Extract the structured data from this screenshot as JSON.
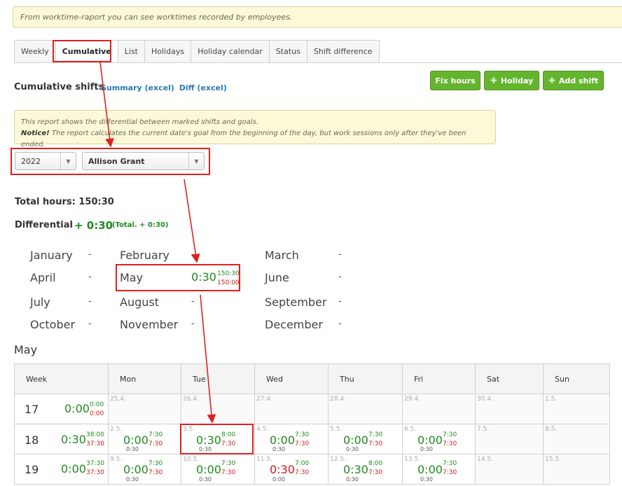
{
  "info_text": "From worktime-raport you can see worktimes recorded by employees.",
  "tabs": [
    {
      "label": "Weekly"
    },
    {
      "label": "Cumulative"
    },
    {
      "label": "List"
    },
    {
      "label": "Holidays"
    },
    {
      "label": "Holiday calendar"
    },
    {
      "label": "Status"
    },
    {
      "label": "Shift difference"
    }
  ],
  "title": "Cumulative shifts",
  "links": {
    "summary": "Summary (excel)",
    "diff": "Diff (excel)"
  },
  "buttons": {
    "fix_hours": "Fix hours",
    "holiday": "Holiday",
    "add_shift": "Add shift"
  },
  "notice": {
    "line1": "This report shows the differential between marked shifts and goals.",
    "notice_label": "Notice!",
    "line2": " The report calculates the current date's goal from the beginning of the day, but work sessions only after they've been ended."
  },
  "selects": {
    "year": "2022",
    "employee": "Allison Grant"
  },
  "total_label": "Total hours:",
  "total_value": "150:30",
  "diff_label": "Differential",
  "diff_value": "+ 0:30",
  "diff_total": "(Total. + 0:30)",
  "months": [
    {
      "name": "January",
      "dash": "-"
    },
    {
      "name": "February",
      "dash": "-"
    },
    {
      "name": "March",
      "dash": "-"
    },
    {
      "name": "April",
      "dash": "-"
    },
    {
      "name": "May",
      "diff": "0:30",
      "worked": "150:30",
      "goal": "150:00"
    },
    {
      "name": "June",
      "dash": "-"
    },
    {
      "name": "July",
      "dash": "-"
    },
    {
      "name": "August",
      "dash": "-"
    },
    {
      "name": "September",
      "dash": "-"
    },
    {
      "name": "October",
      "dash": "-"
    },
    {
      "name": "November",
      "dash": "-"
    },
    {
      "name": "December",
      "dash": "-"
    }
  ],
  "section_title": "May",
  "grid": {
    "headers": [
      "Week",
      "Mon",
      "Tue",
      "Wed",
      "Thu",
      "Fri",
      "Sat",
      "Sun"
    ],
    "rows": [
      {
        "week": "17",
        "diff": "0:00",
        "worked": "0:00",
        "goal": "0:00",
        "days": [
          {
            "date": "25.4."
          },
          {
            "date": "26.4."
          },
          {
            "date": "27.4."
          },
          {
            "date": "28.4."
          },
          {
            "date": "29.4."
          },
          {
            "date": "30.4."
          },
          {
            "date": "1.5."
          }
        ]
      },
      {
        "week": "18",
        "diff": "0:30",
        "worked": "38:00",
        "goal": "37:30",
        "days": [
          {
            "date": "2.5.",
            "diff": "0:00",
            "worked": "7:30",
            "goal": "7:30",
            "under": "0:30"
          },
          {
            "date": "3.5.",
            "diff": "0:30",
            "worked": "8:00",
            "goal": "7:30",
            "under": "0:30"
          },
          {
            "date": "4.5.",
            "diff": "0:00",
            "worked": "7:30",
            "goal": "7:30",
            "under": "0:30"
          },
          {
            "date": "5.5.",
            "diff": "0:00",
            "worked": "7:30",
            "goal": "7:30",
            "under": "0:30"
          },
          {
            "date": "6.5.",
            "diff": "0:00",
            "worked": "7:30",
            "goal": "7:30",
            "under": "0:30"
          },
          {
            "date": "7.5."
          },
          {
            "date": "8.5."
          }
        ]
      },
      {
        "week": "19",
        "diff": "0:00",
        "worked": "37:30",
        "goal": "37:30",
        "days": [
          {
            "date": "9.5.",
            "diff": "0:00",
            "worked": "7:30",
            "goal": "7:30",
            "under": "0:30"
          },
          {
            "date": "10.5.",
            "diff": "0:00",
            "worked": "7:30",
            "goal": "7:30",
            "under": "0:30"
          },
          {
            "date": "11.5.",
            "diff": "0:30",
            "worked": "7:00",
            "goal": "7:30",
            "under": "0:00",
            "negative": true
          },
          {
            "date": "12.5.",
            "diff": "0:30",
            "worked": "8:00",
            "goal": "7:30",
            "under": "0:30"
          },
          {
            "date": "13.5.",
            "diff": "0:00",
            "worked": "7:30",
            "goal": "7:30",
            "under": "0:30"
          },
          {
            "date": "14.5."
          },
          {
            "date": "15.5."
          }
        ]
      }
    ]
  }
}
